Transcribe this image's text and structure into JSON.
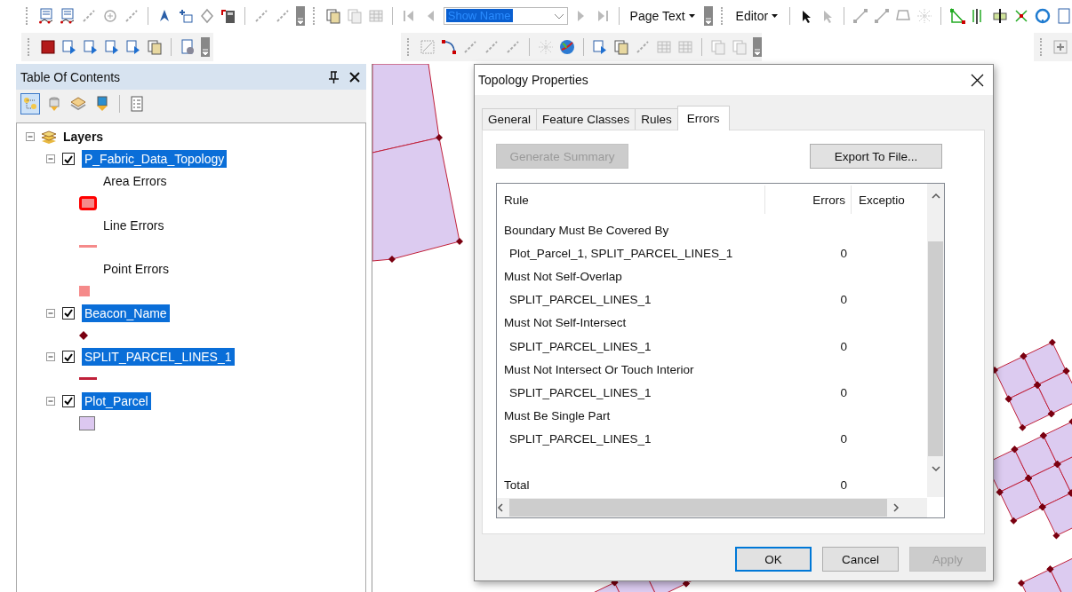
{
  "toolbar": {
    "name_field": {
      "value": "Show Name"
    },
    "menus": [
      {
        "label": "Page Text"
      },
      {
        "label": "Editor"
      }
    ]
  },
  "table_of_contents": {
    "title": "Table Of Contents",
    "tools": [
      {
        "selected": true
      },
      {
        "selected": false
      },
      {
        "selected": false
      },
      {
        "selected": false
      },
      {
        "selected": false
      }
    ],
    "tree": {
      "label": "Layers",
      "expanded": true,
      "children": [
        {
          "label": "P_Fabric_Data_Topology",
          "checked": true,
          "selected": true,
          "expanded": true,
          "legend": [
            {
              "label": "Area Errors",
              "kind": "area",
              "color": "#f58a8a"
            },
            {
              "label": "Line Errors",
              "kind": "line",
              "color": "#f58a8a"
            },
            {
              "label": "Point Errors",
              "kind": "point",
              "color": "#f58a8a"
            }
          ]
        },
        {
          "label": "Beacon_Name",
          "checked": true,
          "selected": true,
          "expanded": true,
          "legend": [
            {
              "kind": "marker",
              "color": "#7a0010"
            }
          ]
        },
        {
          "label": "SPLIT_PARCEL_LINES_1",
          "checked": true,
          "selected": true,
          "expanded": true,
          "legend": [
            {
              "kind": "line",
              "color": "#c0203a"
            }
          ]
        },
        {
          "label": "Plot_Parcel",
          "checked": true,
          "selected": true,
          "expanded": true,
          "legend": [
            {
              "kind": "area_plain",
              "color": "#dcc8f0"
            }
          ]
        }
      ]
    }
  },
  "dialog": {
    "title": "Topology Properties",
    "tabs": [
      {
        "label": "General",
        "selected": false
      },
      {
        "label": "Feature Classes",
        "selected": false
      },
      {
        "label": "Rules",
        "selected": false
      },
      {
        "label": "Errors",
        "selected": true
      }
    ],
    "actions": [
      {
        "label": "Generate Summary",
        "disabled": true
      },
      {
        "label": "Export To File...",
        "disabled": false
      }
    ],
    "table": {
      "columns": [
        "Rule",
        "Errors",
        "Exceptio"
      ],
      "rows": [
        {
          "kind": "heading",
          "rule": "Boundary Must Be Covered By"
        },
        {
          "kind": "detail",
          "rule": "Plot_Parcel_1, SPLIT_PARCEL_LINES_1",
          "errors": "0"
        },
        {
          "kind": "heading",
          "rule": "Must Not Self-Overlap"
        },
        {
          "kind": "detail",
          "rule": "SPLIT_PARCEL_LINES_1",
          "errors": "0"
        },
        {
          "kind": "heading",
          "rule": "Must Not Self-Intersect"
        },
        {
          "kind": "detail",
          "rule": "SPLIT_PARCEL_LINES_1",
          "errors": "0"
        },
        {
          "kind": "heading",
          "rule": "Must Not Intersect Or Touch Interior"
        },
        {
          "kind": "detail",
          "rule": "SPLIT_PARCEL_LINES_1",
          "errors": "0"
        },
        {
          "kind": "heading",
          "rule": "Must Be Single Part"
        },
        {
          "kind": "detail",
          "rule": "SPLIT_PARCEL_LINES_1",
          "errors": "0"
        },
        {
          "kind": "total",
          "rule": "Total",
          "errors": "0"
        }
      ]
    },
    "buttons": [
      {
        "label": "OK",
        "default": true,
        "disabled": false
      },
      {
        "label": "Cancel",
        "default": false,
        "disabled": false
      },
      {
        "label": "Apply",
        "default": false,
        "disabled": true
      }
    ]
  }
}
